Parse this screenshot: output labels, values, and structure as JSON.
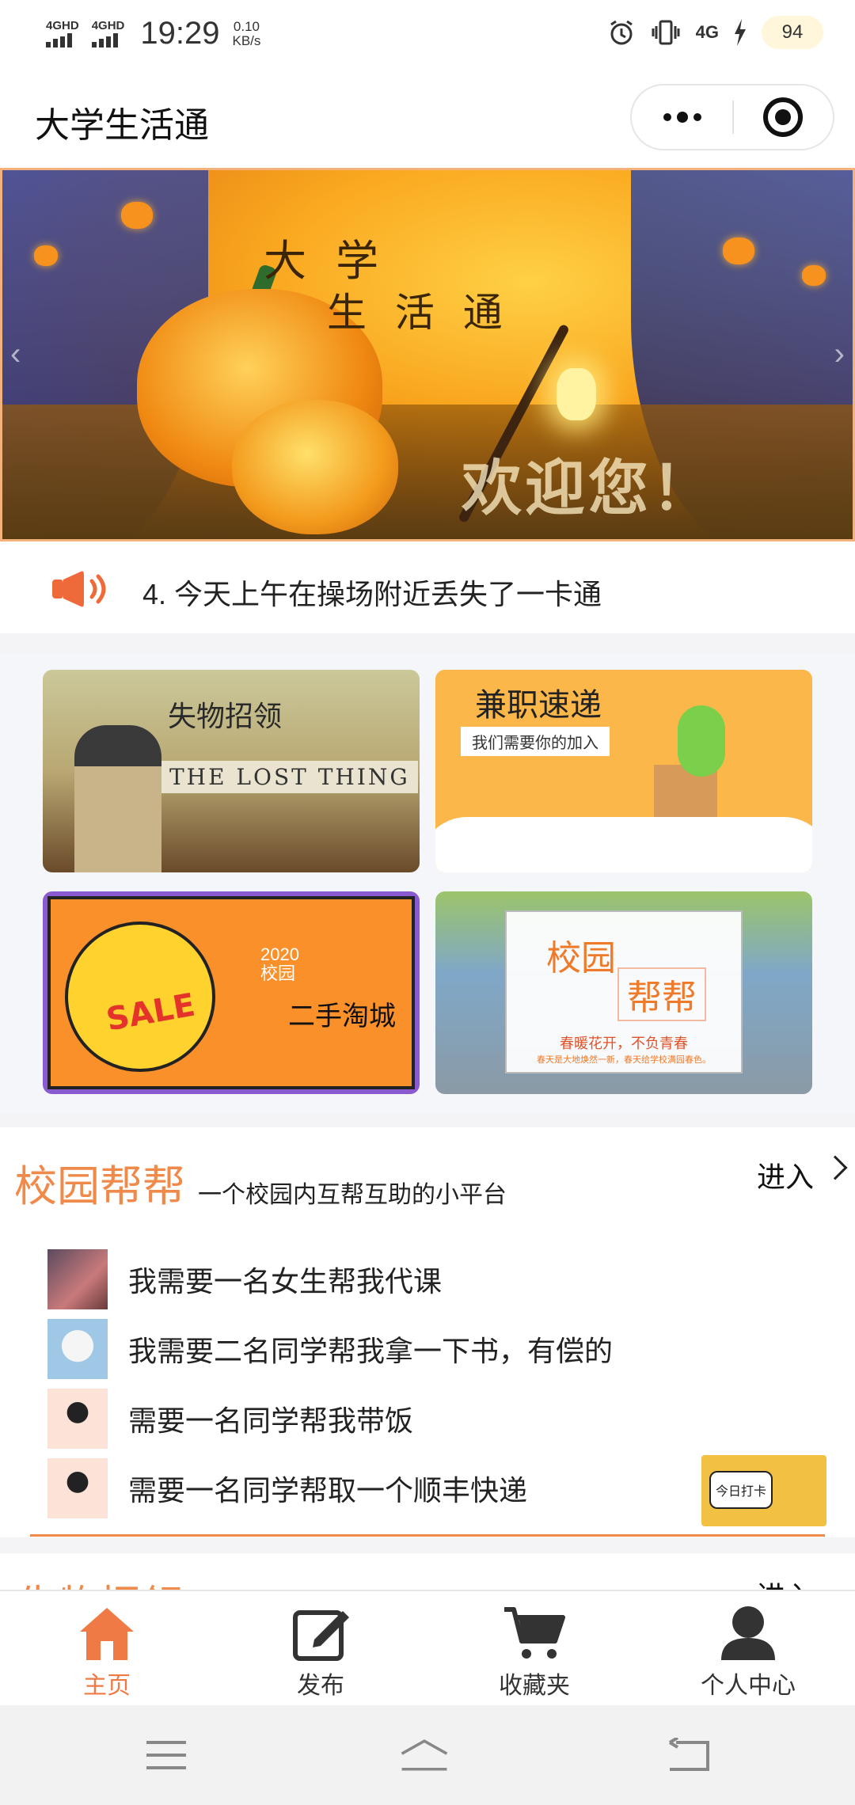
{
  "status_bar": {
    "sim1": "4GHD",
    "sim2": "4GHD",
    "time": "19:29",
    "speed_value": "0.10",
    "speed_unit": "KB/s",
    "network": "4G",
    "battery": "94"
  },
  "nav": {
    "title": "大学生活通"
  },
  "banner": {
    "title_line1": "大 学",
    "title_line2": "生 活 通",
    "welcome": "欢迎您！"
  },
  "notice": {
    "text": "4. 今天上午在操场附近丢失了一卡通"
  },
  "grid": {
    "lost": {
      "title": "失物招领",
      "sign": "THE LOST THING"
    },
    "job": {
      "title": "兼职速递",
      "subtitle": "我们需要你的加入"
    },
    "second": {
      "title": "二手淘城",
      "year": "2020",
      "tag": "校园",
      "sale": "SALE"
    },
    "help": {
      "title1": "校园",
      "title2": "帮帮",
      "slogan": "春暖花开，不负青春",
      "small": "春天是大地焕然一新，春天给学校满园春色。"
    }
  },
  "campus_help": {
    "title": "校园帮帮",
    "subtitle": "一个校园内互帮互助的小平台",
    "enter": "进入",
    "items": [
      {
        "text": "我需要一名女生帮我代课"
      },
      {
        "text": "我需要二名同学帮我拿一下书，有偿的"
      },
      {
        "text": "需要一名同学帮我带饭"
      },
      {
        "text": "需要一名同学帮取一个顺丰快递"
      }
    ],
    "checkin_label": "今日打卡"
  },
  "next_section": {
    "title": "失物招领",
    "enter": "进入"
  },
  "tabs": [
    {
      "label": "主页",
      "icon": "home-icon",
      "active": true
    },
    {
      "label": "发布",
      "icon": "edit-icon",
      "active": false
    },
    {
      "label": "收藏夹",
      "icon": "cart-icon",
      "active": false
    },
    {
      "label": "个人中心",
      "icon": "user-icon",
      "active": false
    }
  ],
  "colors": {
    "accent": "#ef7a45",
    "section_title": "#ef8a4a",
    "tab_inactive": "#333333"
  }
}
